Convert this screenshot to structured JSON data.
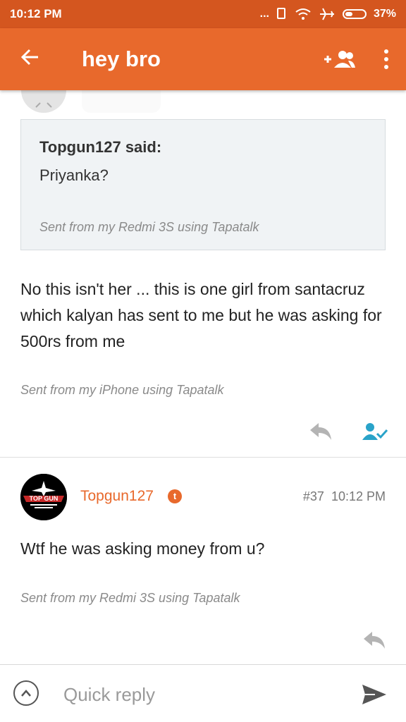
{
  "status": {
    "time": "10:12 PM",
    "dots": "...",
    "battery": "37%"
  },
  "appbar": {
    "title": "hey bro"
  },
  "quote": {
    "author": "Topgun127 said:",
    "text": "Priyanka?",
    "signature": "Sent from my Redmi 3S using Tapatalk"
  },
  "post1": {
    "body": "No this isn't her ... this is one girl from santacruz which kalyan has sent to me but he was asking for 500rs from me",
    "signature": "Sent from my iPhone using Tapatalk"
  },
  "post2": {
    "username": "Topgun127",
    "badge": "t",
    "number": "#37",
    "time": "10:12 PM",
    "avatar_text": "TOP GUN",
    "body": "Wtf he was asking money from u?",
    "signature": "Sent from my Redmi 3S using Tapatalk"
  },
  "reply": {
    "placeholder": "Quick reply"
  },
  "icons": {
    "back": "arrow-left-icon",
    "add_people": "add-people-icon",
    "more": "more-vert-icon",
    "reply": "reply-icon",
    "thanks": "person-check-icon",
    "expand": "chevron-up-icon",
    "send": "send-icon"
  },
  "colors": {
    "status_bar": "#d4561f",
    "app_bar": "#e8692c",
    "accent": "#e8692c",
    "thanks_icon": "#29a3c9"
  }
}
